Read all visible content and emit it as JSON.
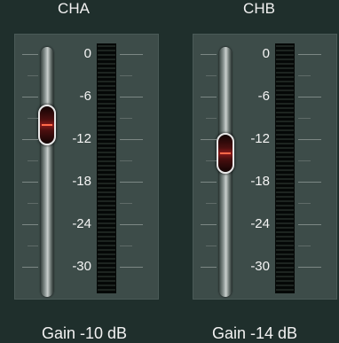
{
  "channels": [
    {
      "title": "CHA",
      "gain_label": "Gain -10 dB",
      "fader_level_db": -10
    },
    {
      "title": "CHB",
      "gain_label": "Gain -14 dB",
      "fader_level_db": -14
    }
  ],
  "scale": [
    "0",
    "-6",
    "-12",
    "-18",
    "-24",
    "-30"
  ],
  "colors": {
    "background": "#1f2f2c",
    "panel": "#3d4c49",
    "knob_accent": "#ff6a4a",
    "meter": "#050807"
  }
}
